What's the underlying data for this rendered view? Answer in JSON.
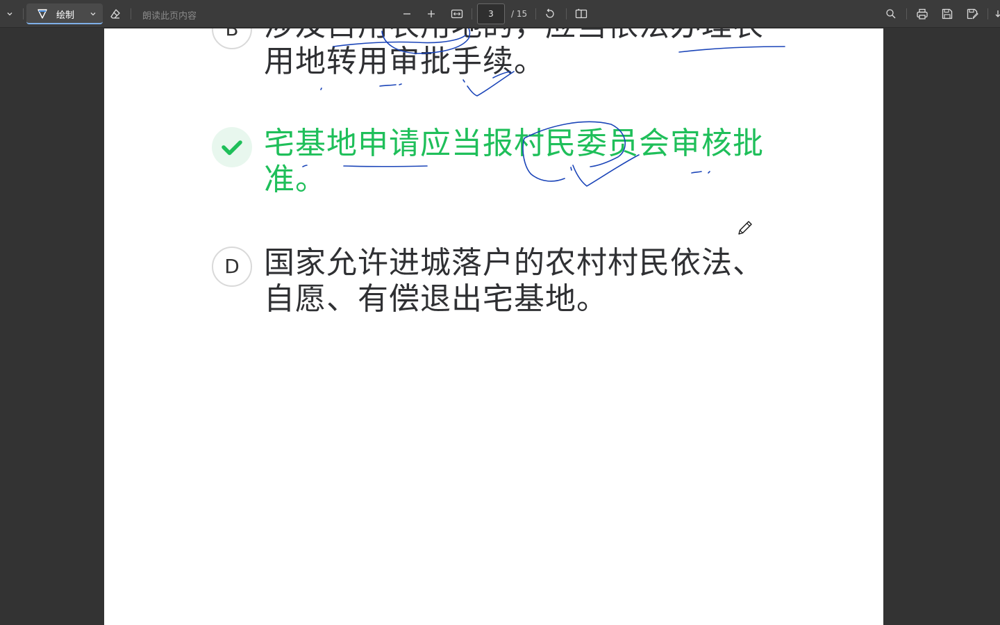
{
  "toolbar": {
    "draw_label": "绘制",
    "read_aloud_label": "朗读此页内容",
    "current_page": "3",
    "total_pages": "/ 15"
  },
  "document": {
    "options": [
      {
        "letter": "B",
        "text": "涉及占用农用地的，应当依法办理农用地转用审批手续。",
        "state": "normal"
      },
      {
        "letter": "",
        "text": "宅基地申请应当报村民委员会审核批准。",
        "state": "correct"
      },
      {
        "letter": "D",
        "text": "国家允许进城落户的农村村民依法、自愿、有偿退出宅基地。",
        "state": "normal"
      }
    ]
  },
  "colors": {
    "toolbar_bg": "#3b3b3b",
    "canvas_bg": "#333333",
    "correct_green": "#1fbf5a",
    "ink_blue": "#1a44b8"
  },
  "icons": [
    "chevron-down-icon",
    "draw-pen-icon",
    "eraser-icon",
    "zoom-out-icon",
    "zoom-in-icon",
    "fit-width-icon",
    "rotate-icon",
    "two-page-icon",
    "search-icon",
    "print-icon",
    "save-icon",
    "save-as-icon",
    "checkmark-icon",
    "pencil-cursor-icon"
  ]
}
